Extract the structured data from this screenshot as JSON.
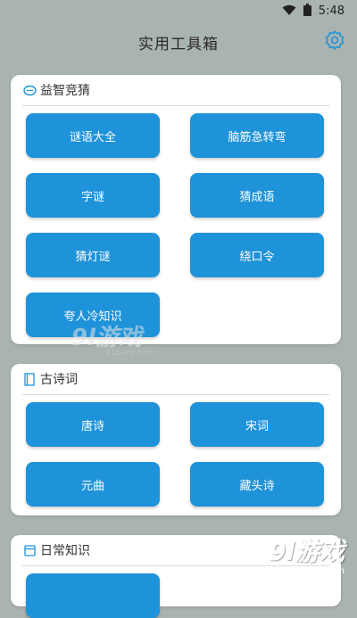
{
  "status": {
    "time": "5:48"
  },
  "app": {
    "title": "实用工具箱"
  },
  "sections": [
    {
      "title": "益智竞猜",
      "items": [
        "谜语大全",
        "脑筋急转弯",
        "字谜",
        "猜成语",
        "猜灯谜",
        "绕口令",
        "夸人冷知识"
      ]
    },
    {
      "title": "古诗词",
      "items": [
        "唐诗",
        "宋词",
        "元曲",
        "藏头诗"
      ]
    },
    {
      "title": "日常知识",
      "items": []
    }
  ],
  "watermarks": {
    "center_logo": "9l游戏",
    "center_site": "91danji.com",
    "corner_logo": "9l游戏",
    "corner_site": "91danji.com"
  },
  "colors": {
    "background": "#a9b3af",
    "button": "#1f93d9",
    "settings_icon": "#1f93d9"
  }
}
